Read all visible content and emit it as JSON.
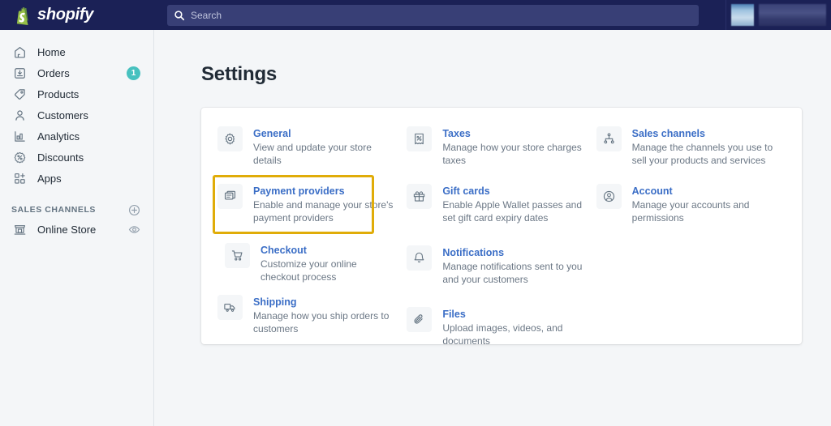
{
  "topbar": {
    "logo_icon": "shopify-bag-icon",
    "logo_text": "shopify",
    "search": {
      "icon": "search-icon",
      "placeholder": "Search",
      "value": ""
    },
    "account": {
      "redacted": true,
      "avatar_icon": "store-avatar-redacted",
      "name_redacted": ""
    }
  },
  "sidebar": {
    "items": [
      {
        "label": "Home",
        "icon": "home-icon",
        "badge": ""
      },
      {
        "label": "Orders",
        "icon": "orders-icon",
        "badge": "1"
      },
      {
        "label": "Products",
        "icon": "tag-icon",
        "badge": ""
      },
      {
        "label": "Customers",
        "icon": "person-icon",
        "badge": ""
      },
      {
        "label": "Analytics",
        "icon": "bar-chart-icon",
        "badge": ""
      },
      {
        "label": "Discounts",
        "icon": "discount-icon",
        "badge": ""
      },
      {
        "label": "Apps",
        "icon": "apps-icon",
        "badge": ""
      }
    ],
    "sales_channels": {
      "title": "SALES CHANNELS",
      "add_icon": "plus-circle-icon",
      "items": [
        {
          "label": "Online Store",
          "icon": "storefront-icon",
          "trailing_icon": "eye-icon"
        }
      ]
    }
  },
  "main": {
    "page_title": "Settings",
    "columns": [
      {
        "items": [
          {
            "title": "General",
            "desc": "View and update your store details",
            "icon": "gear-icon",
            "highlighted": false
          },
          {
            "title": "Payment providers",
            "desc": "Enable and manage your store's payment providers",
            "icon": "payment-icon",
            "highlighted": false
          },
          {
            "title": "Checkout",
            "desc": "Customize your online checkout process",
            "icon": "cart-icon",
            "highlighted": true
          },
          {
            "title": "Shipping",
            "desc": "Manage how you ship orders to customers",
            "icon": "truck-icon",
            "highlighted": false
          }
        ]
      },
      {
        "items": [
          {
            "title": "Taxes",
            "desc": "Manage how your store charges taxes",
            "icon": "taxes-icon",
            "highlighted": false
          },
          {
            "title": "Gift cards",
            "desc": "Enable Apple Wallet passes and set gift card expiry dates",
            "icon": "gift-icon",
            "highlighted": false
          },
          {
            "title": "Notifications",
            "desc": "Manage notifications sent to you and your customers",
            "icon": "bell-icon",
            "highlighted": false
          },
          {
            "title": "Files",
            "desc": "Upload images, videos, and documents",
            "icon": "paperclip-icon",
            "highlighted": false
          }
        ]
      },
      {
        "items": [
          {
            "title": "Sales channels",
            "desc": "Manage the channels you use to sell your products and services",
            "icon": "network-icon",
            "highlighted": false
          },
          {
            "title": "Account",
            "desc": "Manage your accounts and permissions",
            "icon": "account-circle-icon",
            "highlighted": false
          }
        ]
      }
    ]
  },
  "colors": {
    "topbar_bg": "#1b2156",
    "search_bg": "#383f76",
    "sidebar_bg": "#f4f6f8",
    "page_bg": "#f4f6f8",
    "card_bg": "#ffffff",
    "link_blue": "#3b6ec6",
    "text_dark": "#212b36",
    "text_muted": "#6b7785",
    "badge_teal": "#47c1bf",
    "highlight_gold": "#e0ac08",
    "logo_green": "#95bf47"
  }
}
